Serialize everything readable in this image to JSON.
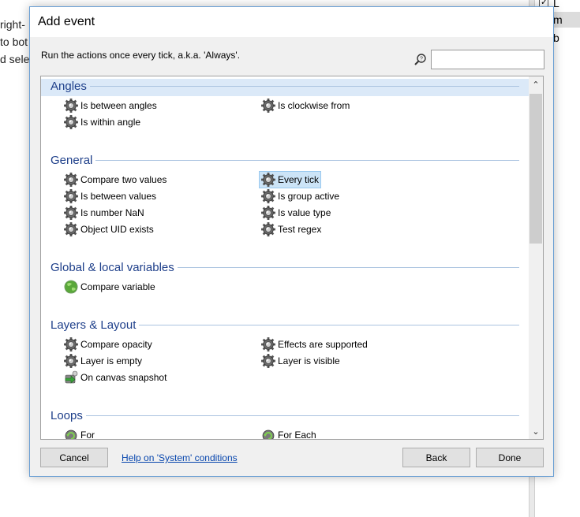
{
  "background": {
    "left_text": [
      "right-",
      "to bot",
      "d selec"
    ],
    "right_rows": [
      {
        "label": "L",
        "icon": "checkbox-icon"
      },
      {
        "label": "m",
        "icon": "lock-icon"
      },
      {
        "label": "b",
        "icon": "lock-icon"
      }
    ]
  },
  "dialog": {
    "title": "Add event",
    "description": "Run the actions once every tick, a.k.a. 'Always'.",
    "search": {
      "value": "",
      "placeholder": ""
    },
    "categories": [
      {
        "label": "Angles",
        "items": [
          "Is between angles",
          "Is clockwise from",
          "Is within angle"
        ]
      },
      {
        "label": "General",
        "items": [
          "Compare two values",
          "Every tick",
          "Is between values",
          "Is group active",
          "Is number NaN",
          "Is value type",
          "Object UID exists",
          "Test regex"
        ]
      },
      {
        "label": "Global & local variables",
        "items": [
          "Compare variable"
        ]
      },
      {
        "label": "Layers & Layout",
        "items": [
          "Compare opacity",
          "Effects are supported",
          "Layer is empty",
          "Layer is visible",
          "On canvas snapshot"
        ]
      },
      {
        "label": "Loops",
        "items": [
          "For",
          "For Each"
        ]
      }
    ],
    "selected_item": "Every tick",
    "buttons": {
      "cancel": "Cancel",
      "help": "Help on 'System' conditions",
      "back": "Back",
      "done": "Done"
    },
    "colors": {
      "category_text": "#1e3f8a",
      "selection": "#cce4f7",
      "link": "#0645ad"
    }
  }
}
